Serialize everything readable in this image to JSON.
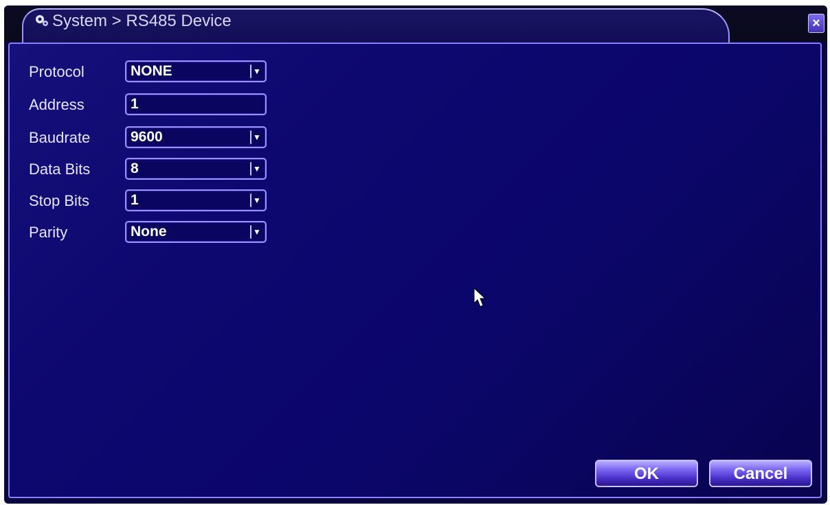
{
  "window": {
    "title": "System > RS485 Device",
    "close_label": "×"
  },
  "form": {
    "fields": [
      {
        "label": "Protocol",
        "value": "NONE",
        "type": "dropdown"
      },
      {
        "label": "Address",
        "value": "1",
        "type": "text"
      },
      {
        "label": "Baudrate",
        "value": "9600",
        "type": "dropdown"
      },
      {
        "label": "Data Bits",
        "value": "8",
        "type": "dropdown"
      },
      {
        "label": "Stop Bits",
        "value": "1",
        "type": "dropdown"
      },
      {
        "label": "Parity",
        "value": "None",
        "type": "dropdown"
      }
    ]
  },
  "buttons": {
    "ok_label": "OK",
    "cancel_label": "Cancel"
  },
  "icons": {
    "title_icon": "system-settings-icon",
    "dropdown_icon": "chevron-down-icon",
    "cursor_icon": "mouse-cursor-icon"
  },
  "colors": {
    "background": "#0b066a",
    "border_accent": "#9c92ff",
    "text": "#ffffff"
  }
}
